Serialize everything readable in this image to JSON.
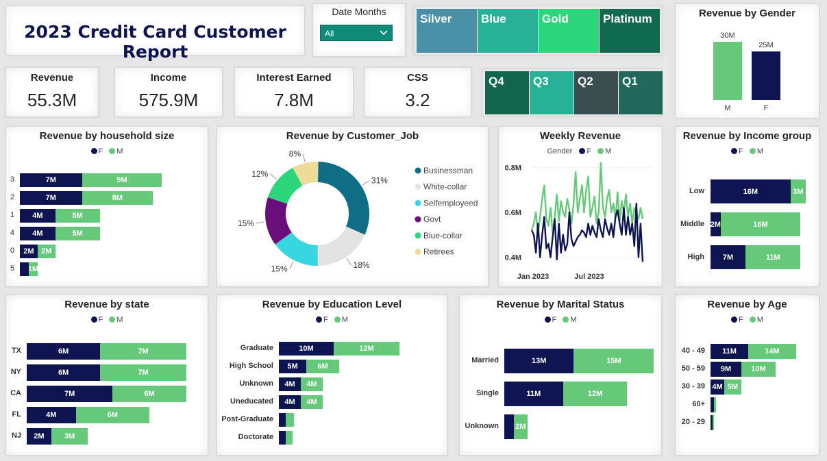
{
  "title": "2023 Credit Card Customer Report",
  "filter": {
    "label": "Date Months",
    "value": "All"
  },
  "card_tiles": [
    {
      "label": "Silver",
      "color": "#4a8fa8"
    },
    {
      "label": "Blue",
      "color": "#27b197"
    },
    {
      "label": "Gold",
      "color": "#2bd67c"
    },
    {
      "label": "Platinum",
      "color": "#116a4f"
    }
  ],
  "quarter_tiles": [
    {
      "label": "Q4",
      "color": "#12664d"
    },
    {
      "label": "Q3",
      "color": "#27b197"
    },
    {
      "label": "Q2",
      "color": "#3b4d4f"
    },
    {
      "label": "Q1",
      "color": "#22695b"
    }
  ],
  "kpis": [
    {
      "label": "Revenue",
      "value": "55.3M"
    },
    {
      "label": "Income",
      "value": "575.9M"
    },
    {
      "label": "Interest Earned",
      "value": "7.8M"
    },
    {
      "label": "CSS",
      "value": "3.2"
    }
  ],
  "legend": {
    "f": "F",
    "m": "M",
    "gender_title": "Gender"
  },
  "colors": {
    "female": "#0d1450",
    "male": "#66c97a"
  },
  "chart_data": [
    {
      "id": "gender",
      "type": "bar",
      "title": "Revenue by Gender",
      "categories": [
        "M",
        "F"
      ],
      "values": [
        30,
        25
      ],
      "labels": [
        "30M",
        "25M"
      ],
      "unit": "M"
    },
    {
      "id": "household",
      "type": "bar",
      "title": "Revenue by household size",
      "categories": [
        "3",
        "2",
        "1",
        "4",
        "0",
        "5"
      ],
      "series": [
        {
          "name": "F",
          "values": [
            7,
            7,
            4,
            4,
            2,
            1
          ],
          "labels": [
            "7M",
            "7M",
            "4M",
            "4M",
            "2M",
            ""
          ]
        },
        {
          "name": "M",
          "values": [
            9,
            8,
            5,
            5,
            2,
            1
          ],
          "labels": [
            "9M",
            "8M",
            "5M",
            "5M",
            "2M",
            "1M"
          ]
        }
      ]
    },
    {
      "id": "job",
      "type": "pie",
      "title": "Revenue by Customer_Job",
      "slices": [
        {
          "name": "Businessman",
          "value": 31,
          "label": "31%",
          "color": "#0f6e85"
        },
        {
          "name": "White-collar",
          "value": 18,
          "label": "18%",
          "color": "#e3e3e3"
        },
        {
          "name": "Selfemployeed",
          "value": 15,
          "label": "15%",
          "color": "#38d6e0"
        },
        {
          "name": "Govt",
          "value": 15,
          "label": "15%",
          "color": "#6a0f7a"
        },
        {
          "name": "Blue-collar",
          "value": 12,
          "label": "12%",
          "color": "#2bd67c"
        },
        {
          "name": "Retirees",
          "value": 8,
          "label": "8%",
          "color": "#ecdc98"
        }
      ]
    },
    {
      "id": "weekly",
      "type": "line",
      "title": "Weekly Revenue",
      "y_ticks": [
        "0.8M",
        "0.6M",
        "0.4M"
      ],
      "ylim": [
        0.35,
        0.85
      ],
      "x_ticks": [
        "Jan 2023",
        "Jul 2023"
      ],
      "series": [
        {
          "name": "F",
          "values": [
            0.52,
            0.5,
            0.42,
            0.55,
            0.4,
            0.5,
            0.58,
            0.44,
            0.46,
            0.4,
            0.49,
            0.57,
            0.39,
            0.55,
            0.42,
            0.5,
            0.43,
            0.46,
            0.6,
            0.48,
            0.45,
            0.47,
            0.49,
            0.5,
            0.52,
            0.51,
            0.49,
            0.55,
            0.5,
            0.54,
            0.51,
            0.49,
            0.57,
            0.52,
            0.49,
            0.57,
            0.53,
            0.5,
            0.55,
            0.49,
            0.58,
            0.61,
            0.55,
            0.5,
            0.62,
            0.5,
            0.58,
            0.5,
            0.55,
            0.45,
            0.64,
            0.4,
            0.55,
            0.38
          ]
        },
        {
          "name": "M",
          "values": [
            0.52,
            0.55,
            0.6,
            0.5,
            0.58,
            0.66,
            0.72,
            0.57,
            0.54,
            0.62,
            0.51,
            0.58,
            0.68,
            0.56,
            0.65,
            0.6,
            0.58,
            0.66,
            0.61,
            0.55,
            0.64,
            0.78,
            0.6,
            0.66,
            0.72,
            0.6,
            0.7,
            0.76,
            0.58,
            0.62,
            0.67,
            0.55,
            0.6,
            0.82,
            0.62,
            0.58,
            0.66,
            0.7,
            0.6,
            0.64,
            0.57,
            0.69,
            0.56,
            0.65,
            0.6,
            0.68,
            0.58,
            0.64,
            0.55,
            0.62,
            0.6,
            0.57,
            0.62,
            0.57
          ]
        }
      ]
    },
    {
      "id": "income",
      "type": "bar",
      "title": "Revenue by Income group",
      "categories": [
        "Low",
        "Middle",
        "High"
      ],
      "series": [
        {
          "name": "F",
          "values": [
            16,
            2,
            7
          ],
          "labels": [
            "16M",
            "2M",
            "7M"
          ]
        },
        {
          "name": "M",
          "values": [
            3,
            16,
            11
          ],
          "labels": [
            "3M",
            "16M",
            "11M"
          ]
        }
      ]
    },
    {
      "id": "state",
      "type": "bar",
      "title": "Revenue by state",
      "categories": [
        "TX",
        "NY",
        "CA",
        "FL",
        "NJ"
      ],
      "series": [
        {
          "name": "F",
          "values": [
            6,
            6,
            7,
            4,
            2
          ],
          "labels": [
            "6M",
            "6M",
            "7M",
            "4M",
            "2M"
          ]
        },
        {
          "name": "M",
          "values": [
            7,
            7,
            6,
            6,
            3
          ],
          "labels": [
            "7M",
            "7M",
            "6M",
            "6M",
            "3M"
          ]
        }
      ]
    },
    {
      "id": "education",
      "type": "bar",
      "title": "Revenue by Education Level",
      "categories": [
        "Graduate",
        "High School",
        "Unknown",
        "Uneducated",
        "Post-Graduate",
        "Doctorate"
      ],
      "series": [
        {
          "name": "F",
          "values": [
            10,
            5,
            4,
            4,
            1.2,
            1.2
          ],
          "labels": [
            "10M",
            "5M",
            "4M",
            "4M",
            "",
            ""
          ]
        },
        {
          "name": "M",
          "values": [
            12,
            6,
            4,
            4,
            1.5,
            1.3
          ],
          "labels": [
            "12M",
            "6M",
            "4M",
            "4M",
            "",
            ""
          ]
        }
      ]
    },
    {
      "id": "marital",
      "type": "bar",
      "title": "Revenue by Marital Status",
      "categories": [
        "Married",
        "Single",
        "Unknown"
      ],
      "series": [
        {
          "name": "F",
          "values": [
            13,
            11,
            1.8
          ],
          "labels": [
            "13M",
            "11M",
            ""
          ]
        },
        {
          "name": "M",
          "values": [
            15,
            12,
            2.5
          ],
          "labels": [
            "15M",
            "12M",
            "2M"
          ]
        }
      ]
    },
    {
      "id": "age",
      "type": "bar",
      "title": "Revenue by Age",
      "categories": [
        "40 - 49",
        "50 - 59",
        "30 - 39",
        "60+",
        "20 - 29"
      ],
      "series": [
        {
          "name": "F",
          "values": [
            11,
            9,
            4,
            1.0,
            0.5
          ],
          "labels": [
            "11M",
            "9M",
            "4M",
            "",
            ""
          ]
        },
        {
          "name": "M",
          "values": [
            14,
            10,
            5,
            0.6,
            0.4
          ],
          "labels": [
            "14M",
            "10M",
            "5M",
            "",
            ""
          ]
        }
      ]
    }
  ]
}
